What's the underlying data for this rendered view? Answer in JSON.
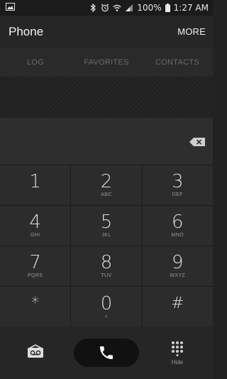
{
  "status_bar": {
    "battery": "100%",
    "time": "1:27 AM",
    "icons": [
      "image-icon",
      "bluetooth-icon",
      "alarm-icon",
      "wifi-icon",
      "signal-icon",
      "battery-icon"
    ]
  },
  "app_bar": {
    "title": "Phone",
    "more_label": "MORE"
  },
  "tabs": [
    "LOG",
    "FAVORITES",
    "CONTACTS"
  ],
  "keypad": {
    "rows": [
      [
        {
          "digit": "1",
          "letters": ""
        },
        {
          "digit": "2",
          "letters": "ABC"
        },
        {
          "digit": "3",
          "letters": "DEF"
        }
      ],
      [
        {
          "digit": "4",
          "letters": "GHI"
        },
        {
          "digit": "5",
          "letters": "JKL"
        },
        {
          "digit": "6",
          "letters": "MNO"
        }
      ],
      [
        {
          "digit": "7",
          "letters": "PQRS"
        },
        {
          "digit": "8",
          "letters": "TUV"
        },
        {
          "digit": "9",
          "letters": "WXYZ"
        }
      ],
      [
        {
          "digit": "*",
          "letters": ""
        },
        {
          "digit": "0",
          "letters": "+"
        },
        {
          "digit": "#",
          "letters": ""
        }
      ]
    ]
  },
  "bottom_bar": {
    "hide_label": "Hide",
    "icons": [
      "voicemail-icon",
      "call-icon",
      "dialpad-icon"
    ]
  },
  "colors": {
    "background": "#242424",
    "text": "#dcdcdc",
    "tab_text": "#6b6b6b",
    "call_button": "#111111"
  }
}
